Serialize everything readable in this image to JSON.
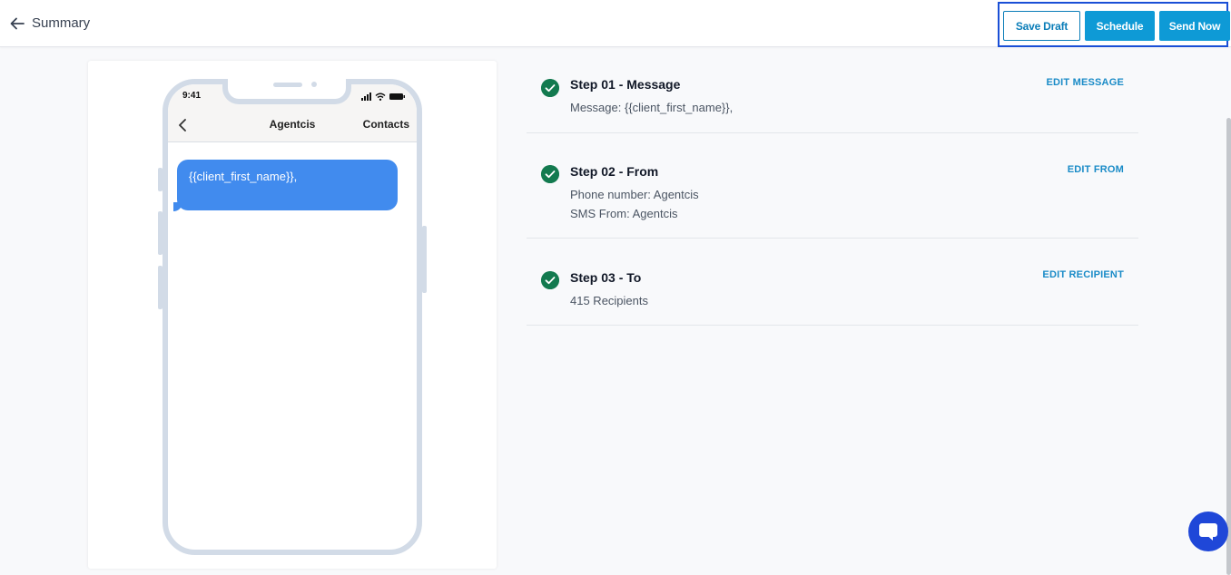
{
  "header": {
    "title": "Summary",
    "buttons": {
      "save_draft": "Save Draft",
      "schedule": "Schedule",
      "send_now": "Send Now"
    }
  },
  "phone": {
    "time": "9:41",
    "nav_title": "Agentcis",
    "nav_contacts": "Contacts",
    "message": "{{client_first_name}},"
  },
  "steps": [
    {
      "title": "Step 01 - Message",
      "details": [
        "Message: {{client_first_name}},"
      ],
      "edit_label": "EDIT MESSAGE"
    },
    {
      "title": "Step 02 - From",
      "details": [
        "Phone number: Agentcis",
        "SMS From: Agentcis"
      ],
      "edit_label": "EDIT FROM"
    },
    {
      "title": "Step 03 - To",
      "details": [
        "415 Recipients"
      ],
      "edit_label": "EDIT RECIPIENT"
    }
  ],
  "colors": {
    "accent": "#0e9ad6",
    "success": "#137a4f",
    "bubble": "#418bee",
    "highlight_border": "#1a4fd6",
    "chat": "#1f47d8"
  },
  "icons": {
    "back": "arrow-left-icon",
    "check": "check-circle-icon",
    "chat": "chat-bubble-icon"
  }
}
